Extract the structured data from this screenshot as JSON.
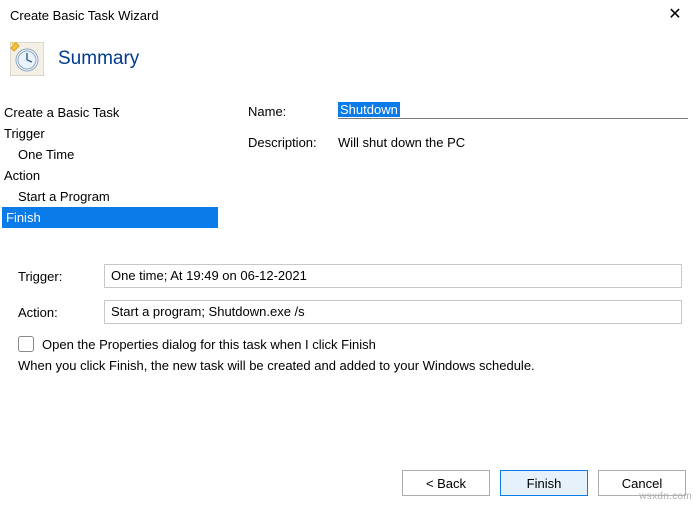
{
  "window": {
    "title": "Create Basic Task Wizard",
    "close_glyph": "✕"
  },
  "header": {
    "title": "Summary"
  },
  "sidebar": {
    "step_create": "Create a Basic Task",
    "step_trigger": "Trigger",
    "step_trigger_sub": "One Time",
    "step_action": "Action",
    "step_action_sub": "Start a Program",
    "step_finish": "Finish"
  },
  "form": {
    "name_label": "Name:",
    "name_value": "Shutdown",
    "desc_label": "Description:",
    "desc_value": "Will shut down the PC"
  },
  "summary": {
    "trigger_label": "Trigger:",
    "trigger_value": "One time; At 19:49 on 06-12-2021",
    "action_label": "Action:",
    "action_value": "Start a program; Shutdown.exe /s",
    "checkbox_label": "Open the Properties dialog for this task when I click Finish",
    "hint": "When you click Finish, the new task will be created and added to your Windows schedule."
  },
  "buttons": {
    "back": "<  Back",
    "finish": "Finish",
    "cancel": "Cancel"
  },
  "watermark": "wsxdn.com"
}
